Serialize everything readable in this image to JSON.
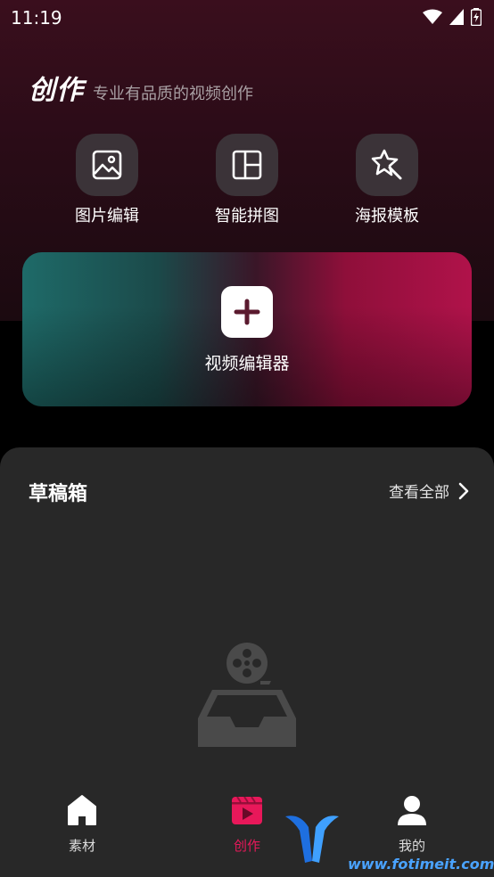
{
  "status": {
    "time": "11:19"
  },
  "brand": {
    "title": "创作",
    "subtitle": "专业有品质的视频创作"
  },
  "tools": [
    {
      "label": "图片编辑",
      "icon": "image-icon"
    },
    {
      "label": "智能拼图",
      "icon": "layout-icon"
    },
    {
      "label": "海报模板",
      "icon": "magic-wand-icon"
    }
  ],
  "video_editor": {
    "label": "视频编辑器",
    "icon": "plus-icon"
  },
  "drafts": {
    "title": "草稿箱",
    "view_all": "查看全部"
  },
  "nav": [
    {
      "label": "素材",
      "icon": "home-icon",
      "active": false
    },
    {
      "label": "创作",
      "icon": "clapper-icon",
      "active": true
    },
    {
      "label": "我的",
      "icon": "user-icon",
      "active": false
    }
  ],
  "watermark": {
    "text": "www.fotimeit.com"
  },
  "colors": {
    "accent": "#e8185a",
    "panel": "#282828",
    "tool_bg": "#3b3338"
  }
}
